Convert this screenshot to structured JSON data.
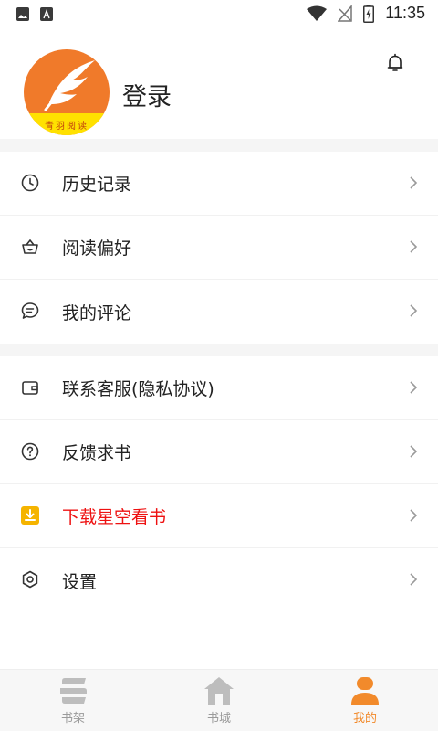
{
  "status_bar": {
    "time": "11:35",
    "icons": [
      "image-notification-icon",
      "a-notification-icon",
      "wifi-icon",
      "no-signal-icon",
      "battery-icon"
    ]
  },
  "profile": {
    "avatar_text": "青羽阅读",
    "login_label": "登录",
    "avatar_color": "#f07a2a",
    "avatar_band_color": "#ffe100"
  },
  "menu": {
    "group1": [
      {
        "label": "历史记录",
        "icon": "clock-icon"
      },
      {
        "label": "阅读偏好",
        "icon": "basket-icon"
      },
      {
        "label": "我的评论",
        "icon": "comment-icon"
      }
    ],
    "group2": [
      {
        "label": "联系客服(隐私协议)",
        "icon": "wallet-icon"
      },
      {
        "label": "反馈求书",
        "icon": "question-icon"
      },
      {
        "label": "下载星空看书",
        "icon": "download-icon",
        "highlight_color": "#ee1111",
        "icon_color": "#f5b400"
      },
      {
        "label": "设置",
        "icon": "settings-icon"
      }
    ]
  },
  "tabbar": {
    "tabs": [
      {
        "label": "书架",
        "icon": "bookshelf-icon"
      },
      {
        "label": "书城",
        "icon": "home-icon"
      },
      {
        "label": "我的",
        "icon": "user-icon",
        "active": true
      }
    ],
    "active_color": "#f28a2b",
    "inactive_color": "#9a9a9a"
  }
}
